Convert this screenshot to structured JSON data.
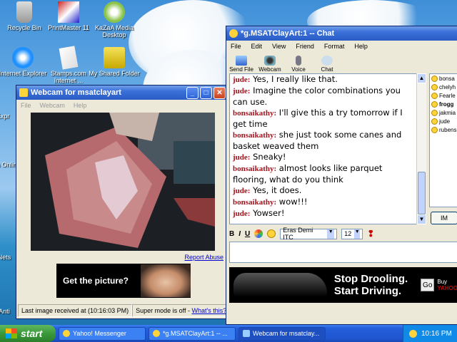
{
  "desktop": {
    "icons": [
      {
        "label": "Recycle Bin"
      },
      {
        "label": "PrintMaster 11"
      },
      {
        "label": "KaZaA Media Desktop"
      },
      {
        "label": "Internet Explorer"
      },
      {
        "label": "Stamps.com Internet ..."
      },
      {
        "label": "My Shared Folder"
      }
    ],
    "partial_labels": [
      "Expr",
      "Insta Onlin",
      "Nets",
      "Anti"
    ]
  },
  "webcam": {
    "title": "Webcam for msatclayart",
    "menu": [
      "File",
      "Webcam",
      "Help"
    ],
    "report_abuse": "Report Abuse",
    "ad_text": "Get the picture?",
    "status_received": "Last image received at (10:16:03 PM)",
    "status_super": "Super mode is off -",
    "status_link": "What's this?"
  },
  "chat": {
    "title": "*g.MSATClayArt:1 -- Chat",
    "menu": [
      "File",
      "Edit",
      "View",
      "Friend",
      "Format",
      "Help"
    ],
    "toolbar": [
      {
        "label": "Send File",
        "icon": "send-file-icon"
      },
      {
        "label": "Webcam",
        "icon": "webcam-icon"
      },
      {
        "label": "Voice",
        "icon": "microphone-icon"
      },
      {
        "label": "Chat",
        "icon": "chat-bubbles-icon"
      }
    ],
    "messages": [
      {
        "who": "jude:",
        "text": "Yes, I really like that."
      },
      {
        "who": "jude:",
        "text": "Imagine the color combinations you can use."
      },
      {
        "who": "bonsaikathy:",
        "text": "I'll give this a try tomorrow if I get time"
      },
      {
        "who": "bonsaikathy:",
        "text": "she just took some canes and basket weaved them"
      },
      {
        "who": "jude:",
        "text": "Sneaky!"
      },
      {
        "who": "bonsaikathy:",
        "text": "almost looks like parquet flooring, what do you think"
      },
      {
        "who": "jude:",
        "text": "Yes, it does."
      },
      {
        "who": "bonsaikathy:",
        "text": "wow!!!"
      },
      {
        "who": "jude:",
        "text": "Yowser!"
      }
    ],
    "buddies": [
      "bonsa",
      "chelyh",
      "Fearle",
      "frogg",
      "jakmia",
      "jude",
      "rubens"
    ],
    "im_button": "IM",
    "format": {
      "bold": "B",
      "italic": "I",
      "underline": "U",
      "font": "Eras Demi ITC",
      "size": "12"
    },
    "ad": {
      "line1": "Stop Drooling.",
      "line2": "Start Driving.",
      "go": "Go",
      "buy": "Buy",
      "brand": "YAHOO"
    }
  },
  "taskbar": {
    "start": "start",
    "tasks": [
      {
        "label": "Yahoo! Messenger"
      },
      {
        "label": "*g.MSATClayArt:1 -- ..."
      },
      {
        "label": "Webcam for msatclay..."
      }
    ],
    "clock": "10:16 PM"
  }
}
